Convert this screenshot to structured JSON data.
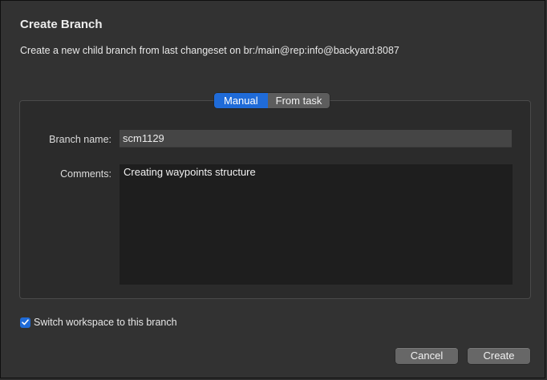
{
  "dialog": {
    "title": "Create Branch",
    "subtitle": "Create a new child branch from last changeset on br:/main@rep:info@backyard:8087"
  },
  "mode_tabs": {
    "manual": "Manual",
    "from_task": "From task",
    "selected": "Manual"
  },
  "form": {
    "branch_name_label": "Branch name:",
    "branch_name_value": "scm1129",
    "comments_label": "Comments:",
    "comments_value": "Creating waypoints structure"
  },
  "switch_workspace": {
    "label": "Switch workspace to this branch",
    "checked": true
  },
  "buttons": {
    "cancel": "Cancel",
    "create": "Create"
  },
  "colors": {
    "accent": "#1f6bd8",
    "background": "#323232"
  }
}
